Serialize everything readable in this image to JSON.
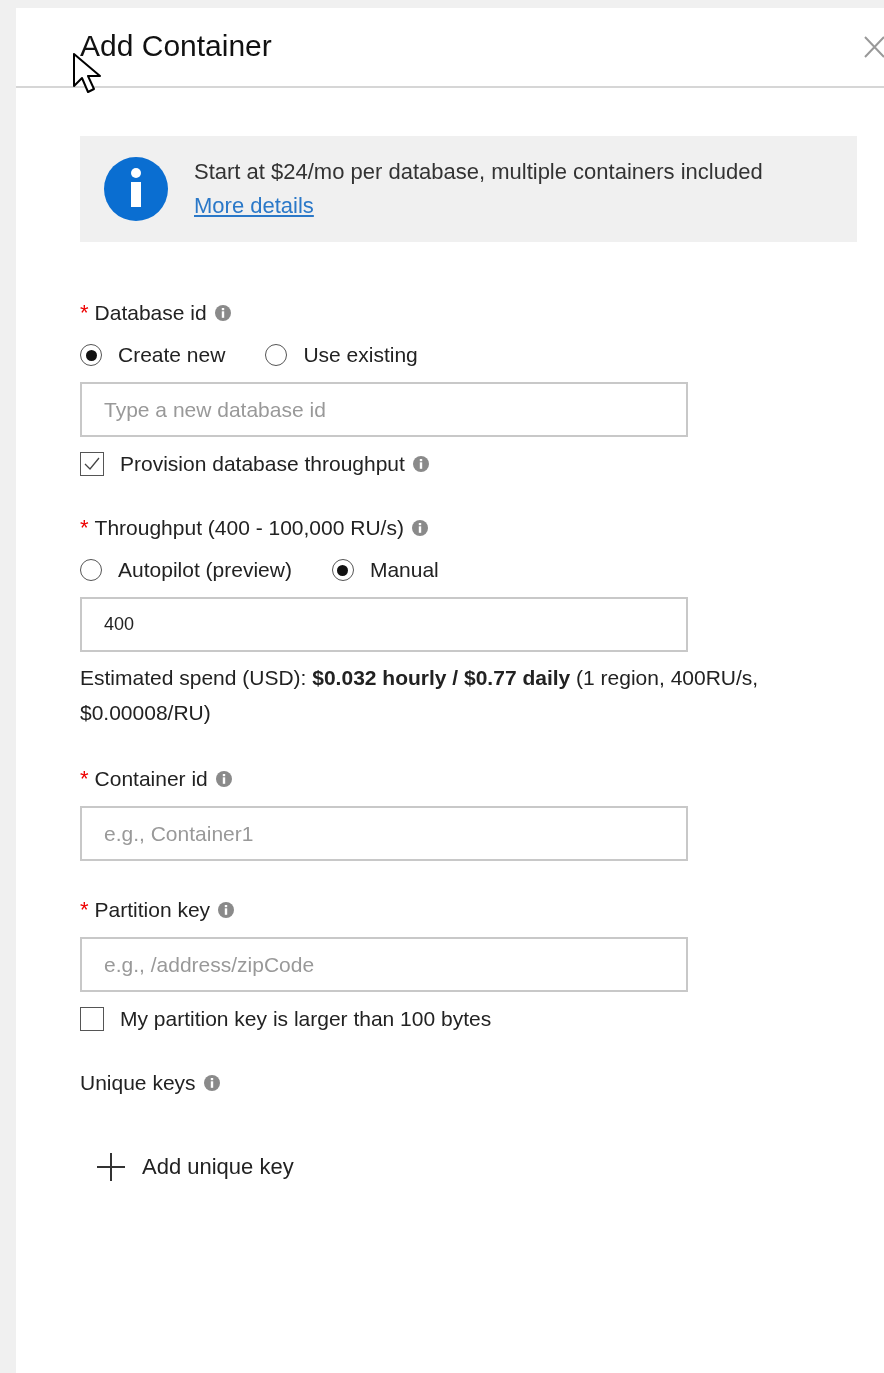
{
  "panel": {
    "title": "Add Container"
  },
  "notice": {
    "text": "Start at $24/mo per database, multiple containers included",
    "link": "More details"
  },
  "groups": [
    {
      "items": [
        {
          "kind": "label",
          "required_mark": "*",
          "text": "Database id",
          "info": true
        },
        {
          "kind": "radios",
          "options": [
            {
              "label": "Create new",
              "selected": true
            },
            {
              "label": "Use existing",
              "selected": false
            }
          ]
        },
        {
          "kind": "input",
          "placeholder": "Type a new database id"
        },
        {
          "kind": "checkbox",
          "label": "Provision database throughput",
          "checked": true,
          "info": true
        }
      ]
    },
    {
      "items": [
        {
          "kind": "label",
          "required_mark": "*",
          "text": "Throughput (400 - 100,000 RU/s)",
          "info": true
        },
        {
          "kind": "radios",
          "options": [
            {
              "label": "Autopilot (preview)",
              "selected": false
            },
            {
              "label": "Manual",
              "selected": true
            }
          ]
        },
        {
          "kind": "input",
          "value": "400"
        },
        {
          "kind": "text",
          "text": "Estimated spend (USD): **$0.032 hourly / $0.77 daily** (1 region, 400RU/s, $0.00008/RU)"
        }
      ]
    },
    {
      "items": [
        {
          "kind": "label",
          "required_mark": "*",
          "text": "Container id",
          "info": true
        },
        {
          "kind": "input",
          "placeholder": "e.g., Container1"
        }
      ]
    },
    {
      "items": [
        {
          "kind": "label",
          "required_mark": "*",
          "text": "Partition key",
          "info": true
        },
        {
          "kind": "input",
          "placeholder": "e.g., /address/zipCode"
        },
        {
          "kind": "checkbox",
          "label": "My partition key is larger than 100 bytes",
          "checked": false,
          "info": false
        }
      ]
    },
    {
      "items": [
        {
          "kind": "label",
          "text": "Unique keys",
          "info": true
        },
        {
          "kind": "add",
          "label": "Add unique key"
        }
      ]
    }
  ]
}
